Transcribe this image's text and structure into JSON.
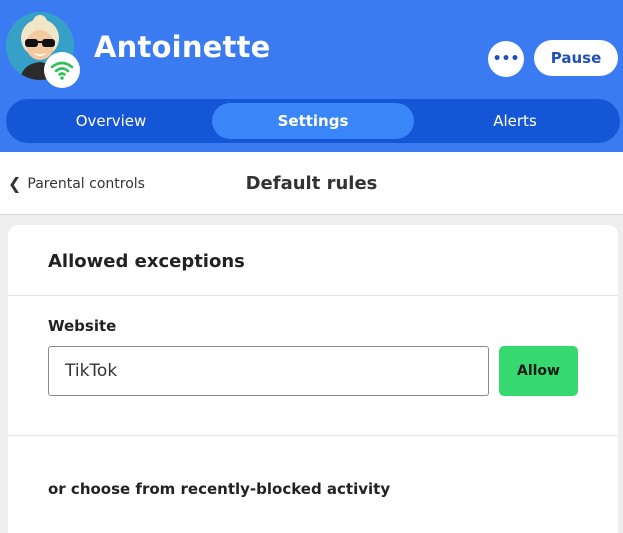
{
  "header": {
    "user_name": "Antoinette",
    "more_label": "•••",
    "pause_label": "Pause",
    "tabs": [
      {
        "label": "Overview",
        "active": false
      },
      {
        "label": "Settings",
        "active": true
      },
      {
        "label": "Alerts",
        "active": false
      }
    ]
  },
  "subheader": {
    "back_label": "Parental controls",
    "title": "Default rules"
  },
  "card": {
    "title": "Allowed exceptions",
    "website_label": "Website",
    "website_value": "TikTok",
    "allow_label": "Allow",
    "helper_text": "or choose from recently-blocked activity"
  },
  "colors": {
    "header_bg": "#3a7bf2",
    "tabs_bg": "#1556d6",
    "active_tab": "#3a86f8",
    "allow_green": "#35d96f",
    "wifi_green": "#2fbf5a"
  },
  "icons": [
    "avatar",
    "wifi-icon",
    "more-icon",
    "chevron-left-icon"
  ]
}
